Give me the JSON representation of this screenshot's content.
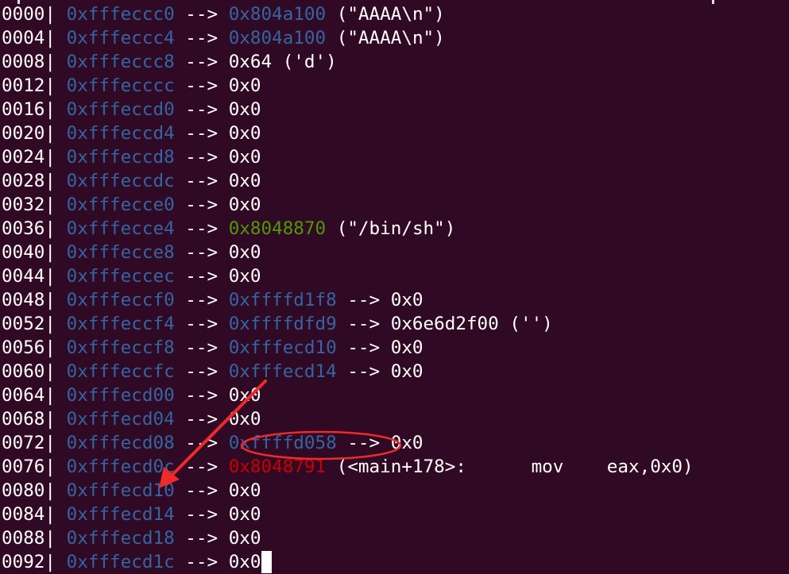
{
  "telescope": {
    "rows": [
      {
        "offset": "0000",
        "address": "0xfffeccc0",
        "chain": [
          {
            "text": "0x804a100",
            "kind": "stack"
          },
          {
            "text": " (\"AAAA\\n\")",
            "kind": "plain"
          }
        ]
      },
      {
        "offset": "0004",
        "address": "0xfffeccc4",
        "chain": [
          {
            "text": "0x804a100",
            "kind": "stack"
          },
          {
            "text": " (\"AAAA\\n\")",
            "kind": "plain"
          }
        ]
      },
      {
        "offset": "0008",
        "address": "0xfffeccc8",
        "chain": [
          {
            "text": "0x64 ('d')",
            "kind": "plain"
          }
        ]
      },
      {
        "offset": "0012",
        "address": "0xfffecccc",
        "chain": [
          {
            "text": "0x0",
            "kind": "plain"
          }
        ]
      },
      {
        "offset": "0016",
        "address": "0xfffeccd0",
        "chain": [
          {
            "text": "0x0",
            "kind": "plain"
          }
        ]
      },
      {
        "offset": "0020",
        "address": "0xfffeccd4",
        "chain": [
          {
            "text": "0x0",
            "kind": "plain"
          }
        ]
      },
      {
        "offset": "0024",
        "address": "0xfffeccd8",
        "chain": [
          {
            "text": "0x0",
            "kind": "plain"
          }
        ]
      },
      {
        "offset": "0028",
        "address": "0xfffeccdc",
        "chain": [
          {
            "text": "0x0",
            "kind": "plain"
          }
        ]
      },
      {
        "offset": "0032",
        "address": "0xfffecce0",
        "chain": [
          {
            "text": "0x0",
            "kind": "plain"
          }
        ]
      },
      {
        "offset": "0036",
        "address": "0xfffecce4",
        "chain": [
          {
            "text": "0x8048870",
            "kind": "data"
          },
          {
            "text": " (\"/bin/sh\")",
            "kind": "plain"
          }
        ]
      },
      {
        "offset": "0040",
        "address": "0xfffecce8",
        "chain": [
          {
            "text": "0x0",
            "kind": "plain"
          }
        ]
      },
      {
        "offset": "0044",
        "address": "0xfffeccec",
        "chain": [
          {
            "text": "0x0",
            "kind": "plain"
          }
        ]
      },
      {
        "offset": "0048",
        "address": "0xfffeccf0",
        "chain": [
          {
            "text": "0xffffd1f8",
            "kind": "stack"
          },
          {
            "text": " --> 0x0",
            "kind": "plain"
          }
        ]
      },
      {
        "offset": "0052",
        "address": "0xfffeccf4",
        "chain": [
          {
            "text": "0xffffdfd9",
            "kind": "stack"
          },
          {
            "text": " --> 0x6e6d2f00 ('')",
            "kind": "plain"
          }
        ]
      },
      {
        "offset": "0056",
        "address": "0xfffeccf8",
        "chain": [
          {
            "text": "0xfffecd10",
            "kind": "stack"
          },
          {
            "text": " --> 0x0",
            "kind": "plain"
          }
        ]
      },
      {
        "offset": "0060",
        "address": "0xfffeccfc",
        "chain": [
          {
            "text": "0xfffecd14",
            "kind": "stack"
          },
          {
            "text": " --> 0x0",
            "kind": "plain"
          }
        ]
      },
      {
        "offset": "0064",
        "address": "0xfffecd00",
        "chain": [
          {
            "text": "0x0",
            "kind": "plain"
          }
        ]
      },
      {
        "offset": "0068",
        "address": "0xfffecd04",
        "chain": [
          {
            "text": "0x0",
            "kind": "plain"
          }
        ]
      },
      {
        "offset": "0072",
        "address": "0xfffecd08",
        "chain": [
          {
            "text": "0xffffd058",
            "kind": "stack"
          },
          {
            "text": " --> 0x0",
            "kind": "plain"
          }
        ]
      },
      {
        "offset": "0076",
        "address": "0xfffecd0c",
        "chain": [
          {
            "text": "0x8048791",
            "kind": "code"
          },
          {
            "text": " (<main+178>:      mov    eax,0x0)",
            "kind": "plain"
          }
        ]
      },
      {
        "offset": "0080",
        "address": "0xfffecd10",
        "chain": [
          {
            "text": "0x0",
            "kind": "plain"
          }
        ]
      },
      {
        "offset": "0084",
        "address": "0xfffecd14",
        "chain": [
          {
            "text": "0x0",
            "kind": "plain"
          }
        ]
      },
      {
        "offset": "0088",
        "address": "0xfffecd18",
        "chain": [
          {
            "text": "0x0",
            "kind": "plain"
          }
        ]
      },
      {
        "offset": "0092",
        "address": "0xfffecd1c",
        "chain": [
          {
            "text": "0x0",
            "kind": "plain"
          }
        ]
      }
    ],
    "separator": "| ",
    "arrow": " --> "
  },
  "colors": {
    "background": "#300a24",
    "stack": "#3465a4",
    "code": "#cc0000",
    "data": "#4e9a06",
    "text": "#ffffff",
    "annotation": "#ee2a2a"
  },
  "annotation": {
    "circled_value": "0xffffd058",
    "arrow_target": "0xfffecd10"
  }
}
